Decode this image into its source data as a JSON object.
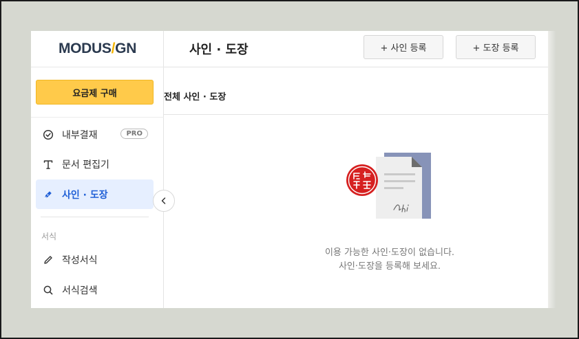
{
  "logo": {
    "left": "MODUS",
    "slash": "/",
    "right": "GN"
  },
  "sidebar": {
    "buy_button": "요금제 구매",
    "items": [
      {
        "label": "내부결재",
        "icon": "check-circle-icon",
        "badge": "PRO",
        "active": false
      },
      {
        "label": "문서 편집기",
        "icon": "text-t-icon",
        "active": false
      },
      {
        "label": "사인 · 도장",
        "icon": "pen-nib-icon",
        "active": true
      }
    ],
    "section_label": "서식",
    "section_items": [
      {
        "label": "작성서식",
        "icon": "pencil-icon"
      },
      {
        "label": "서식검색",
        "icon": "search-icon"
      }
    ]
  },
  "header": {
    "title": "사인 · 도장",
    "add_signature_button": "+ 사인 등록",
    "add_stamp_button": "+ 도장 등록"
  },
  "content": {
    "filter_title": "전체 사인 · 도장",
    "empty_line1": "이용 가능한 사인·도장이 없습니다.",
    "empty_line2": "사인·도장을 등록해 보세요."
  },
  "colors": {
    "accent_yellow": "#ffca4a",
    "active_blue": "#1f5fd6",
    "active_bg": "#e6efff",
    "stamp_red": "#d62020",
    "doc_blue": "#8793b8"
  }
}
